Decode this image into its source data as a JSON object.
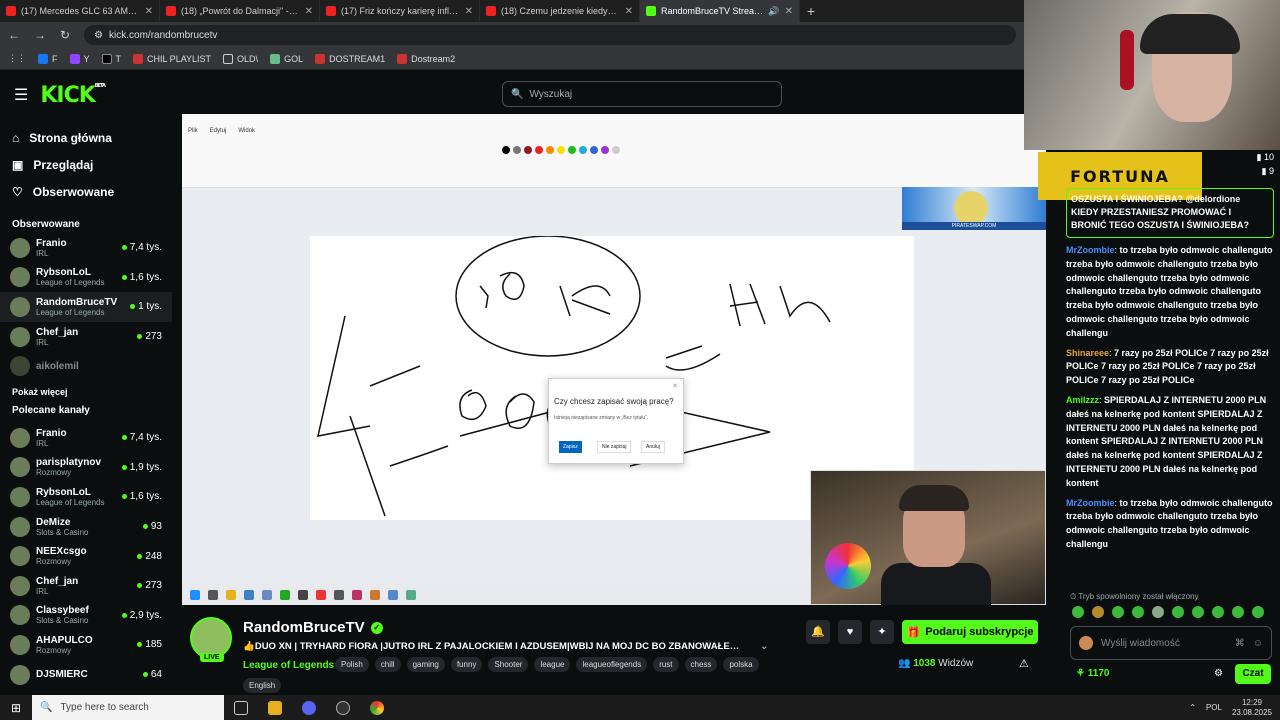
{
  "browser": {
    "tabs": [
      {
        "title": "(17) Mercedes GLC 63 AMG, czy",
        "active": false
      },
      {
        "title": "(18) „Powrót do Dalmacji\" - RO",
        "active": false
      },
      {
        "title": "(17) Friz kończy karierę influenc",
        "active": false
      },
      {
        "title": "(18) Czemu jedzenie kiedyś było",
        "active": false
      },
      {
        "title": "RandomBruceTV Stream - W",
        "active": true
      }
    ],
    "url": "kick.com/randombrucetv",
    "bookmarks": [
      "F",
      "Y",
      "T",
      "CHIL PLAYLIST",
      "OLD\\",
      "GOL",
      "DOSTREAM1",
      "Dostream2"
    ]
  },
  "header": {
    "logo": "KICK",
    "beta": "BETA",
    "search_placeholder": "Wyszukaj"
  },
  "sidebar": {
    "nav": [
      {
        "label": "Strona główna",
        "icon": "home-icon"
      },
      {
        "label": "Przeglądaj",
        "icon": "browse-icon"
      },
      {
        "label": "Obserwowane",
        "icon": "heart-icon"
      }
    ],
    "followed_heading": "Obserwowane",
    "followed": [
      {
        "name": "Franio",
        "category": "IRL",
        "viewers": "7,4 tys."
      },
      {
        "name": "RybsonLoL",
        "category": "League of Legends",
        "viewers": "1,6 tys."
      },
      {
        "name": "RandomBruceTV",
        "category": "League of Legends",
        "viewers": "1 tys."
      },
      {
        "name": "Chef_jan",
        "category": "IRL",
        "viewers": "273"
      },
      {
        "name": "aikolemil",
        "category": "",
        "viewers": ""
      }
    ],
    "show_more": "Pokaż więcej",
    "recommended_heading": "Polecane kanały",
    "recommended": [
      {
        "name": "Franio",
        "category": "IRL",
        "viewers": "7,4 tys."
      },
      {
        "name": "parisplatynov",
        "category": "Rozmowy",
        "viewers": "1,9 tys."
      },
      {
        "name": "RybsonLoL",
        "category": "League of Legends",
        "viewers": "1,6 tys."
      },
      {
        "name": "DeMize",
        "category": "Slots & Casino",
        "viewers": "93"
      },
      {
        "name": "NEEXcsgo",
        "category": "Rozmowy",
        "viewers": "248"
      },
      {
        "name": "Chef_jan",
        "category": "IRL",
        "viewers": "273"
      },
      {
        "name": "Classybeef",
        "category": "Slots & Casino",
        "viewers": "2,9 tys."
      },
      {
        "name": "AHAPULCO",
        "category": "Rozmowy",
        "viewers": "185"
      },
      {
        "name": "DJSMIERC",
        "category": "",
        "viewers": "64"
      }
    ]
  },
  "player": {
    "paint_dialog_title": "Czy chcesz zapisać swoją pracę?",
    "paint_dialog_sub": "Istnieją niezapisane zmiany w „Bez tytułu\".",
    "paint_save": "Zapisz",
    "paint_dont_save": "Nie zapisuj",
    "paint_cancel": "Anuluj",
    "paint_menu": [
      "Plik",
      "Edytuj",
      "Widok"
    ],
    "sticker_text": "PIRATESWAP.COM"
  },
  "stream": {
    "streamer": "RandomBruceTV",
    "live": "LIVE",
    "title": "👍DUO XN | TRYHARD FIORA |JUTRO IRL Z PAJALOCKIEM I AZDUSEM|WBIJ NA MOJ DC BO ZBANOWAŁEM H...",
    "category": "League of Legends",
    "tags": [
      "Polish",
      "chill",
      "gaming",
      "funny",
      "Shooter",
      "league",
      "leagueoflegends",
      "rust",
      "chess",
      "polska"
    ],
    "tag_extra": "English",
    "subscribe": "Podaruj subskrypcje",
    "viewers": "1038",
    "viewers_label": "Widzów"
  },
  "chat": {
    "overlay_brand": "FORTUNA",
    "top_counts": [
      "10",
      "9"
    ],
    "pinned": "OSZUSTA I ŚWINIOJEBA? @delordione KIEDY PRZESTANIESZ PROMOWAĆ I BRONIĆ TEGO OSZUSTA I ŚWINIOJEBA?",
    "messages": [
      {
        "user": "MrZoombie",
        "color": "#4b8cff",
        "text": "to trzeba było odmwoic challenguto trzeba było odmwoic challenguto trzeba było odmwoic challenguto trzeba było odmwoic challenguto trzeba było odmwoic challenguto trzeba było odmwoic challenguto trzeba było odmwoic challenguto trzeba było odmwoic challengu"
      },
      {
        "user": "Shinareee",
        "color": "#e6a23c",
        "text": "7 razy po 25zł POLICe 7 razy po 25zł POLICe 7 razy po 25zł POLICe 7 razy po 25zł POLICe 7 razy po 25zł POLICe"
      },
      {
        "user": "Amilzzz",
        "color": "#53fc18",
        "text": "SPIERDALAJ Z INTERNETU 2000 PLN dałeś na kelnerkę pod kontent SPIERDALAJ Z INTERNETU 2000 PLN dałeś na kelnerkę pod kontent SPIERDALAJ Z INTERNETU 2000 PLN dałeś na kelnerkę pod kontent SPIERDALAJ Z INTERNETU 2000 PLN dałeś na kelnerkę pod kontent"
      },
      {
        "user": "MrZoombie",
        "color": "#4b8cff",
        "text": "to trzeba było odmwoic challenguto trzeba było odmwoic challenguto trzeba było odmwoic challenguto trzeba było odmwoic challengu"
      }
    ],
    "slowmode_notice": "Tryb spowolniony został włączony",
    "input_placeholder": "Wyślij wiadomość",
    "points": "1170",
    "send": "Czat"
  },
  "taskbar": {
    "search_placeholder": "Type here to search",
    "lang": "POL",
    "time": "12:29",
    "date": "23.08.2025"
  },
  "colors": {
    "accent": "#53fc18",
    "background": "#0b0e0f",
    "brand_fortuna": "#e4c21a"
  }
}
